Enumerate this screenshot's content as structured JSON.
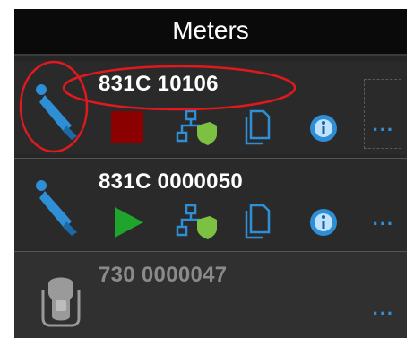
{
  "window": {
    "title": "Meters"
  },
  "meters": [
    {
      "serial": "831C 10106",
      "state_icon": "stop-icon",
      "menu": "..."
    },
    {
      "serial": "831C 0000050",
      "state_icon": "play-icon",
      "menu": "..."
    },
    {
      "serial": "730 0000047",
      "state_icon": "none",
      "menu": "..."
    }
  ],
  "colors": {
    "accent": "#2e8fd6",
    "stop": "#8b0000",
    "play": "#1fa52b",
    "annotation": "#e0191f"
  }
}
